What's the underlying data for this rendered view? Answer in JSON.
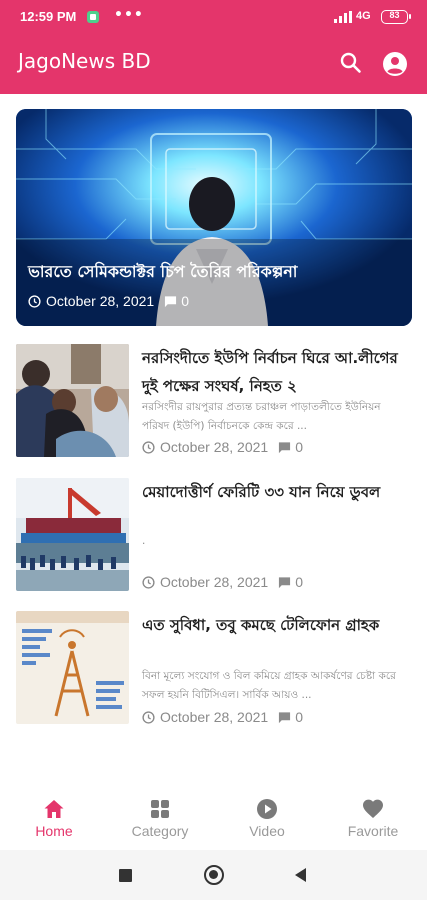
{
  "status_bar": {
    "time": "12:59 PM",
    "dots": "•••",
    "network": "4G",
    "battery": "83"
  },
  "app_bar": {
    "title": "JagoNews BD",
    "icons": [
      "search-icon",
      "account-circle-icon"
    ]
  },
  "featured": {
    "title": "ভারতে সেমিকন্ডাক্টর চিপ তৈরির পরিকল্পনা",
    "date": "October 28, 2021",
    "comments": "0"
  },
  "articles": [
    {
      "title": "নরসিংদীতে ইউপি নির্বাচন ঘিরে আ.লীগের দুই পক্ষের সংঘর্ষ, নিহত ২",
      "excerpt": "নরসিংদীর রায়পুরার প্রত্যন্ত চরাঞ্চল পাড়াতলীতে ইউনিয়ন পরিষদ (ইউপি) নির্বাচনকে কেন্দ্র করে ...",
      "date": "October 28, 2021",
      "comments": "0"
    },
    {
      "title": "মেয়াদোত্তীর্ণ ফেরিটি ৩৩ যান নিয়ে ডুবল",
      "excerpt": ".",
      "date": "October 28, 2021",
      "comments": "0"
    },
    {
      "title": "এত সুবিধা, তবু কমছে টেলিফোন গ্রাহক",
      "excerpt": "বিনা মূল্যে সংযোগ ও বিল কমিয়ে গ্রাহক আকর্ষণের চেষ্টা করে সফল হয়নি বিটিসিএল। সার্বিক আয়ও ...",
      "date": "October 28, 2021",
      "comments": "0"
    }
  ],
  "bottom_nav": {
    "items": [
      {
        "label": "Home",
        "icon": "home-icon",
        "active": true
      },
      {
        "label": "Category",
        "icon": "grid-icon",
        "active": false
      },
      {
        "label": "Video",
        "icon": "play-circle-icon",
        "active": false
      },
      {
        "label": "Favorite",
        "icon": "heart-icon",
        "active": false
      }
    ]
  },
  "colors": {
    "primary": "#e4356b",
    "text": "#1f1f1f",
    "muted": "#8a8a8a"
  }
}
